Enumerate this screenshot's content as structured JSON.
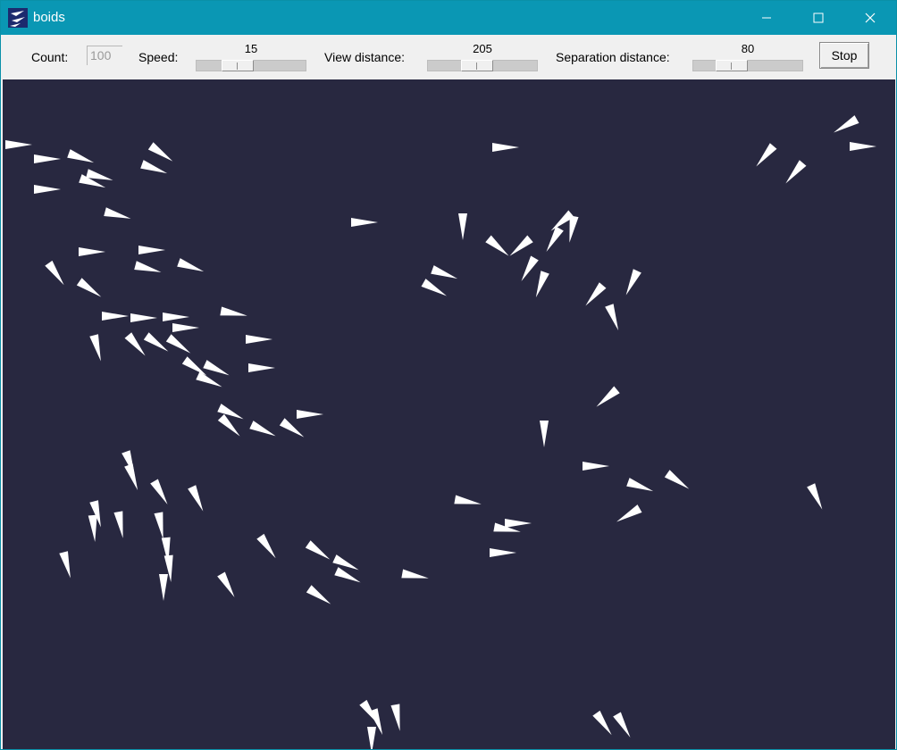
{
  "window": {
    "title": "boids",
    "icon": "boids-app-icon",
    "titlebar_color": "#0a97b4"
  },
  "toolbar": {
    "count_label": "Count:",
    "count_value": "100",
    "speed_label": "Speed:",
    "speed_value": "15",
    "speed_level": 0.33,
    "view_label": "View distance:",
    "view_value": "205",
    "view_level": 0.43,
    "sep_label": "Separation distance:",
    "sep_value": "80",
    "sep_level": 0.3,
    "stop_label": "Stop"
  },
  "canvas": {
    "background": "#282840",
    "boid_color": "#ffffff"
  }
}
